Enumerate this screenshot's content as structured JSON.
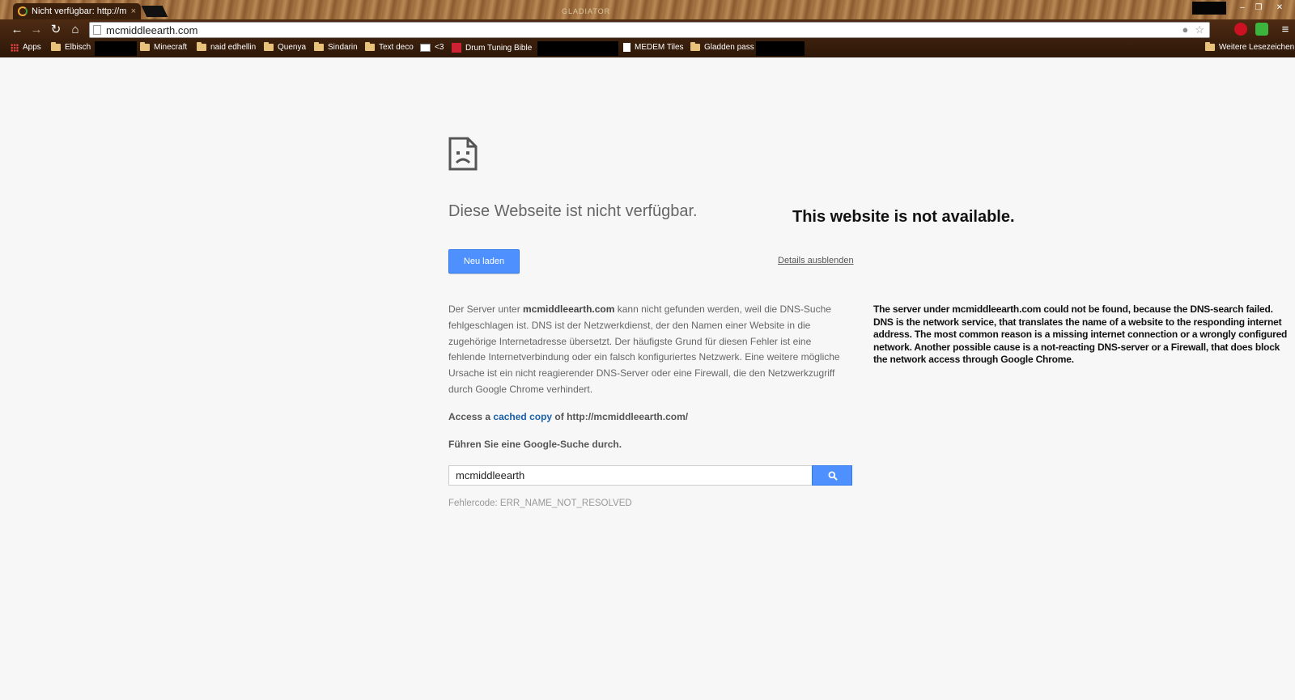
{
  "tab": {
    "title": "Nicht verfügbar: http://m",
    "close_glyph": "×"
  },
  "window": {
    "title_text": "GLADIATOR"
  },
  "toolbar": {
    "url": "mcmiddleearth.com",
    "back_glyph": "←",
    "forward_glyph": "→",
    "reload_glyph": "↻",
    "home_glyph": "⌂",
    "star_glyph": "☆",
    "menu_glyph": "≡"
  },
  "bookmarks": {
    "items": [
      {
        "label": "Apps",
        "icon": "apps-grid-icon"
      },
      {
        "label": "Elbisch",
        "icon": "folder-icon"
      },
      {
        "label": "Minecraft",
        "icon": "folder-icon"
      },
      {
        "label": "naid edhellin",
        "icon": "folder-icon"
      },
      {
        "label": "Quenya",
        "icon": "folder-icon"
      },
      {
        "label": "Sindarin",
        "icon": "folder-icon"
      },
      {
        "label": "Text deco",
        "icon": "folder-icon"
      },
      {
        "label": "<3",
        "icon": "mail-icon"
      },
      {
        "label": "Drum Tuning Bible",
        "icon": "bookmark-favicon-icon"
      },
      {
        "label": "MEDEM Tiles",
        "icon": "page-icon"
      },
      {
        "label": "Gladden pass",
        "icon": "folder-icon"
      }
    ],
    "other": "Weitere Lesezeichen"
  },
  "page": {
    "heading_de": "Diese Webseite ist nicht verfügbar.",
    "heading_en": "This website is not available.",
    "reload_label": "Neu laden",
    "details_label": "Details ausblenden",
    "explain_de_prefix": "Der Server unter ",
    "explain_de_domain": "mcmiddleearth.com",
    "explain_de_rest": " kann nicht gefunden werden, weil die DNS-Suche fehlgeschlagen ist. DNS ist der Netzwerkdienst, der den Namen einer Website in die zugehörige Internetadresse übersetzt. Der häufigste Grund für diesen Fehler ist eine fehlende Internetverbindung oder ein falsch konfiguriertes Netzwerk. Eine weitere mögliche Ursache ist ein nicht reagierender DNS-Server oder eine Firewall, die den Netzwerkzugriff durch Google Chrome verhindert.",
    "explain_en": "The server under mcmiddleearth.com could not be found, because the DNS-search failed. DNS is the network service, that translates the name of a website to the responding internet address. The most common reason is a missing internet connection or a wrongly configured network. Another possible cause is a not-reacting DNS-server or a Firewall, that does block the network access through Google Chrome.",
    "cache_prefix": "Access a ",
    "cache_link": "cached copy",
    "cache_suffix": " of http://mcmiddleearth.com/",
    "search_label": "Führen Sie eine Google-Suche durch.",
    "search_value": "mcmiddleearth",
    "error_code": "Fehlercode: ERR_NAME_NOT_RESOLVED"
  },
  "colors": {
    "accent_blue": "#4d90fe",
    "link_blue": "#1a5faa",
    "page_bg": "#f7f7f7"
  }
}
